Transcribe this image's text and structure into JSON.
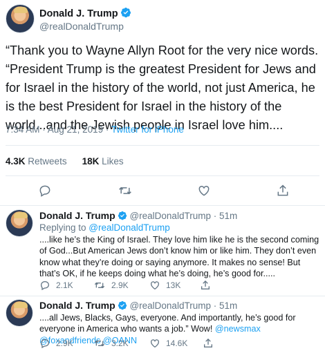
{
  "main_tweet": {
    "name": "Donald J. Trump",
    "handle": "@realDonaldTrump",
    "text": "“Thank you to Wayne Allyn Root for the very nice words. “President Trump is the greatest President for Jews and for Israel in the history of the world, not just America, he is the best President for Israel in the history of the world...and the Jewish people in Israel love him....",
    "timestamp": "7:34 AM · Aug 21, 2019 · ",
    "source": "Twitter for iPhone",
    "retweets_count": "4.3K",
    "retweets_label": "Retweets",
    "likes_count": "18K",
    "likes_label": "Likes"
  },
  "replies": [
    {
      "name": "Donald J. Trump",
      "handle": "@realDonaldTrump",
      "age": "51m",
      "replying_prefix": "Replying to ",
      "replying_to": "@realDonaldTrump",
      "text": "....like he’s the King of Israel. They love him like he is the second coming of God...But American Jews don’t know him or like him. They don’t even know what they’re doing or saying anymore. It makes no sense! But that’s OK, if he keeps doing what he’s doing, he’s good for.....",
      "replies": "2.1K",
      "retweets": "2.9K",
      "likes": "13K"
    },
    {
      "name": "Donald J. Trump",
      "handle": "@realDonaldTrump",
      "age": "51m",
      "text_plain": "....all Jews, Blacks, Gays, everyone. And importantly, he’s good for everyone in America who wants a job.” Wow! ",
      "mention_1": "@newsmax",
      "mention_2": "@foxandfriends",
      "mention_3": "@OANN",
      "replies": "2.9K",
      "retweets": "3.2K",
      "likes": "14.6K"
    }
  ],
  "colors": {
    "accent": "#1da1f2",
    "muted": "#657786",
    "text": "#14171a",
    "divider": "#e6ecf0"
  }
}
